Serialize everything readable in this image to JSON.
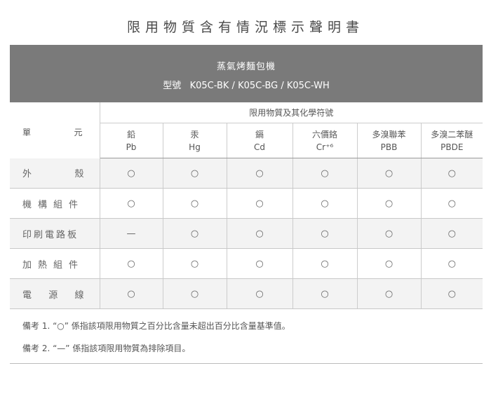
{
  "title": "限用物質含有情況標示聲明書",
  "product": "蒸氣烤麵包機",
  "model_label": "型號",
  "model_value": "K05C-BK / K05C-BG / K05C-WH",
  "table": {
    "unit_header": [
      "單",
      "元"
    ],
    "group_header": "限用物質及其化學符號",
    "substances": [
      {
        "name": "鉛",
        "symbol": "Pb"
      },
      {
        "name": "汞",
        "symbol": "Hg"
      },
      {
        "name": "鎘",
        "symbol": "Cd"
      },
      {
        "name": "六價鉻",
        "symbol": "Cr⁺⁶"
      },
      {
        "name": "多溴聯苯",
        "symbol": "PBB"
      },
      {
        "name": "多溴二苯醚",
        "symbol": "PBDE"
      }
    ],
    "rows": [
      {
        "unit": [
          "外",
          "殼"
        ],
        "values": [
          "○",
          "○",
          "○",
          "○",
          "○",
          "○"
        ]
      },
      {
        "unit": [
          "機",
          "構",
          "組",
          "件"
        ],
        "values": [
          "○",
          "○",
          "○",
          "○",
          "○",
          "○"
        ]
      },
      {
        "unit": [
          "印",
          "刷",
          "電",
          "路",
          "板"
        ],
        "values": [
          "—",
          "○",
          "○",
          "○",
          "○",
          "○"
        ]
      },
      {
        "unit": [
          "加",
          "熱",
          "組",
          "件"
        ],
        "values": [
          "○",
          "○",
          "○",
          "○",
          "○",
          "○"
        ]
      },
      {
        "unit": [
          "電",
          "源",
          "線"
        ],
        "values": [
          "○",
          "○",
          "○",
          "○",
          "○",
          "○"
        ]
      }
    ]
  },
  "notes": [
    "備考 1. “○” 係指該項限用物質之百分比含量未超出百分比含量基準值。",
    "備考 2. “—” 係指該項限用物質為排除項目。"
  ]
}
